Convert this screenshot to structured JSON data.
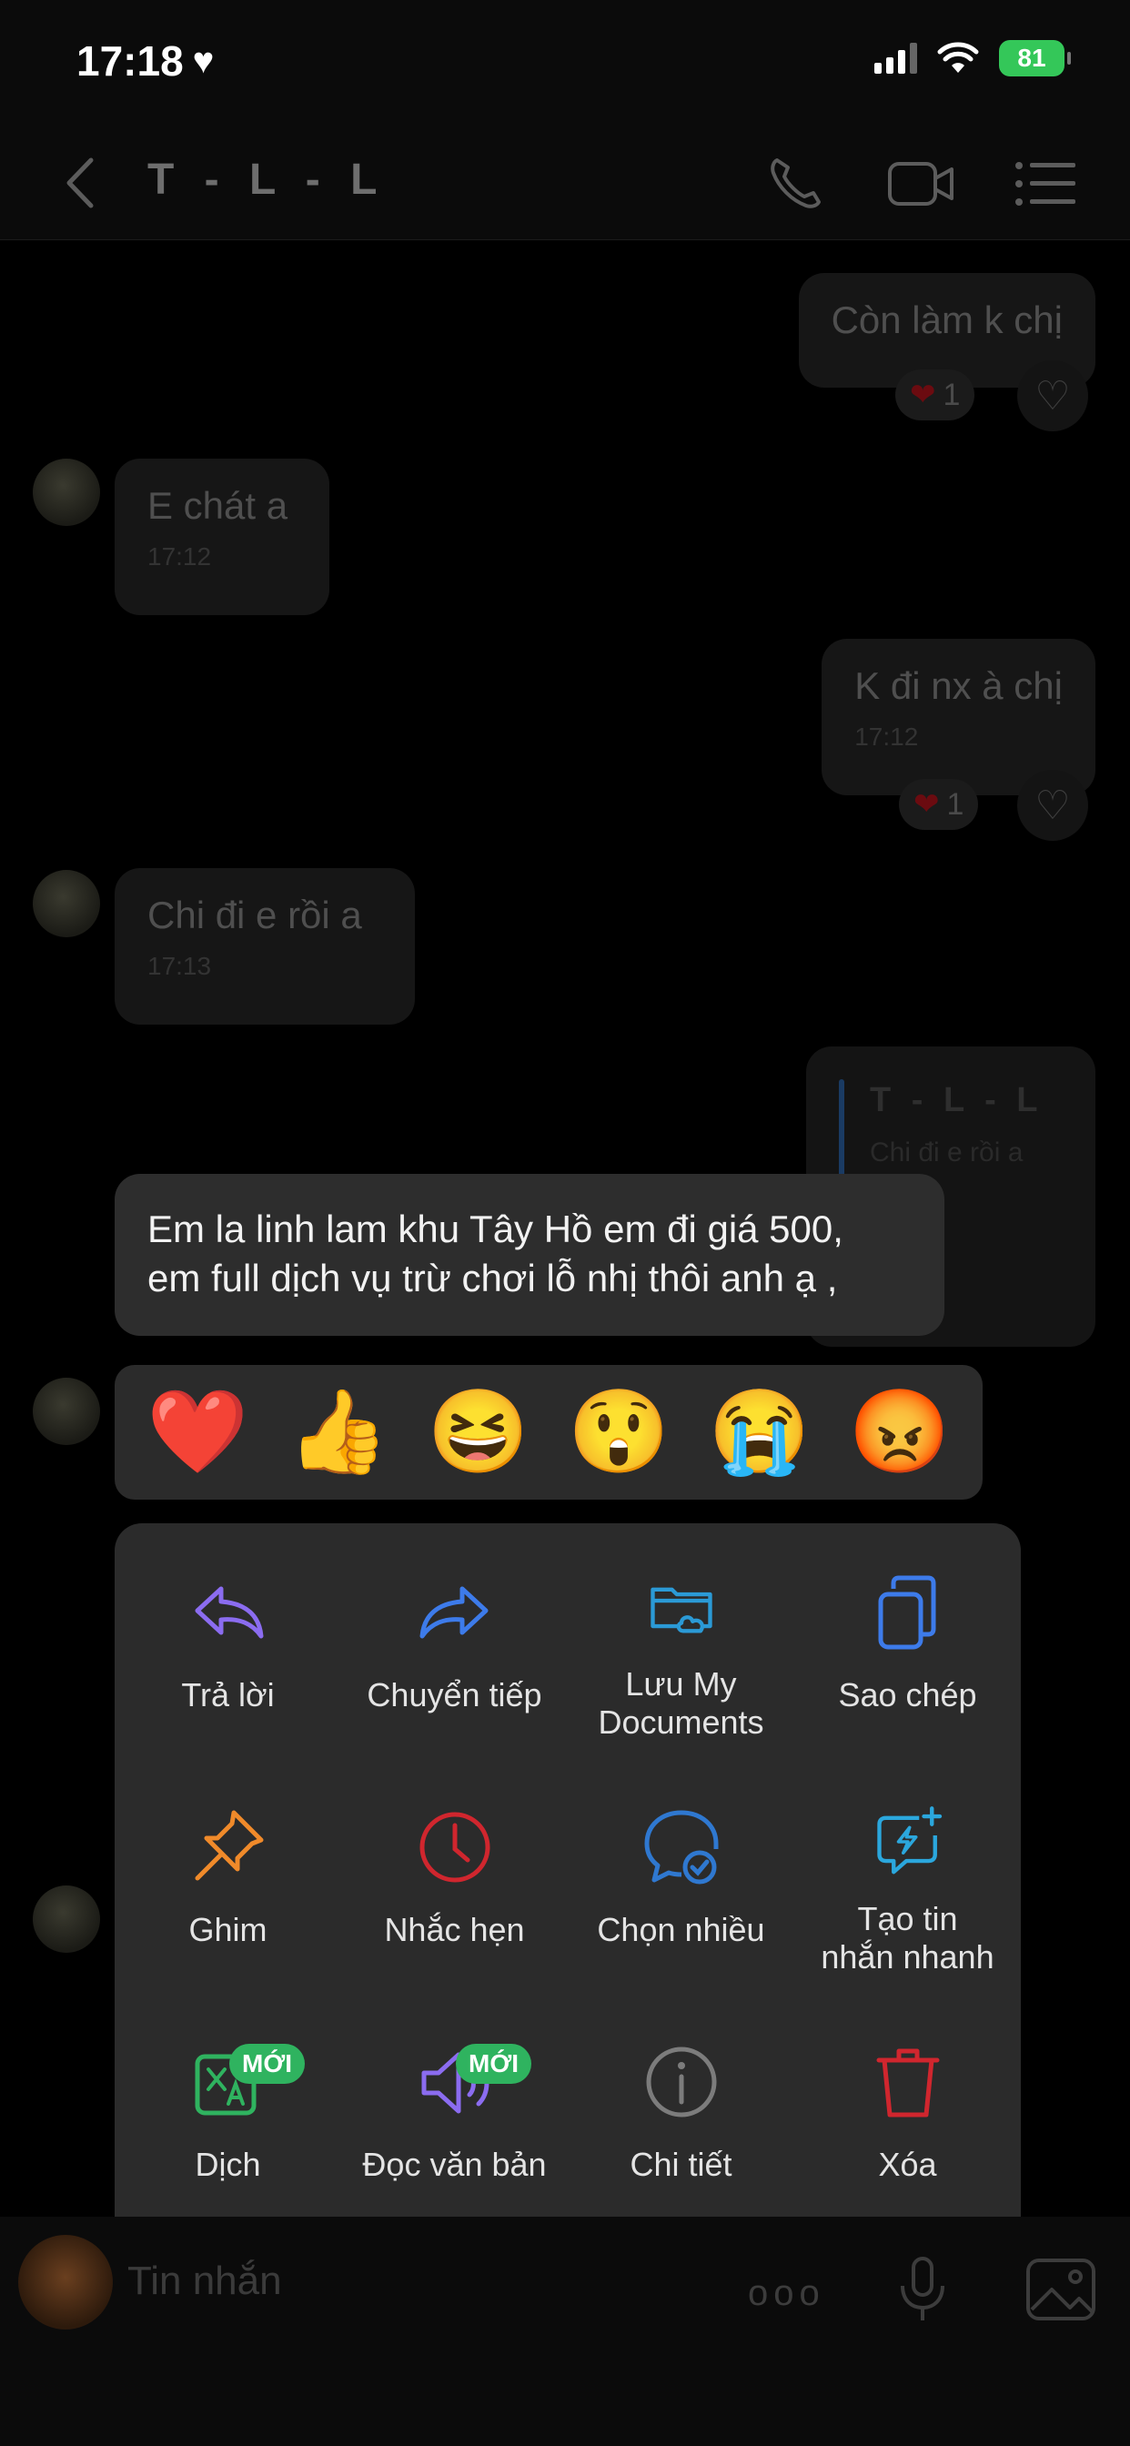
{
  "status": {
    "time": "17:18",
    "heart": "♥",
    "battery": "81"
  },
  "header": {
    "title": "T - L - L",
    "icons": [
      "back-icon",
      "phone-icon",
      "video-icon",
      "list-icon"
    ]
  },
  "messages": [
    {
      "text": "Còn làm k chị",
      "side": "right",
      "reaction_count": "1"
    },
    {
      "text": "E chát a",
      "time": "17:12",
      "side": "left"
    },
    {
      "text": "K đi nx à chị",
      "time": "17:12",
      "side": "right",
      "reaction_count": "1"
    },
    {
      "text": "Chi đi e rồi a",
      "time": "17:13",
      "side": "left"
    }
  ],
  "quote": {
    "title": "T - L - L",
    "snippet": "Chi đi e rồi a"
  },
  "focused_message": {
    "line1": "Em la linh lam khu Tây Hồ em đi giá 500,",
    "line2": "em full dịch vụ trừ chơi lỗ nhị thôi anh ạ ,"
  },
  "reactions": [
    {
      "name": "heart-emoji",
      "glyph": "❤️"
    },
    {
      "name": "thumbs-up-emoji",
      "glyph": "👍"
    },
    {
      "name": "laugh-emoji",
      "glyph": "😆"
    },
    {
      "name": "surprised-emoji",
      "glyph": "😲"
    },
    {
      "name": "cry-emoji",
      "glyph": "😭"
    },
    {
      "name": "angry-emoji",
      "glyph": "😡"
    }
  ],
  "menu": {
    "reply": "Trả lời",
    "forward": "Chuyển tiếp",
    "save_line1": "Lưu My",
    "save_line2": "Documents",
    "copy": "Sao chép",
    "pin": "Ghim",
    "reminder": "Nhắc hẹn",
    "multi_select": "Chọn nhiều",
    "quick_msg_line1": "Tạo tin",
    "quick_msg_line2": "nhắn nhanh",
    "translate": "Dịch",
    "read_aloud": "Đọc văn bản",
    "details": "Chi tiết",
    "delete": "Xóa",
    "new_badge": "MỚI"
  },
  "input": {
    "placeholder": "Tin nhắn",
    "more": "ooo"
  },
  "colors": {
    "reply": "#8b6cf0",
    "forward": "#3d7bea",
    "save": "#2b9ad6",
    "copy": "#3d7bea",
    "pin": "#f08a2a",
    "reminder": "#d0262e",
    "multi": "#2f78d0",
    "quick": "#2ba7dd",
    "translate": "#2fb35f",
    "read": "#8b6cf0",
    "details": "#7c7c7c",
    "delete": "#d0262e"
  }
}
